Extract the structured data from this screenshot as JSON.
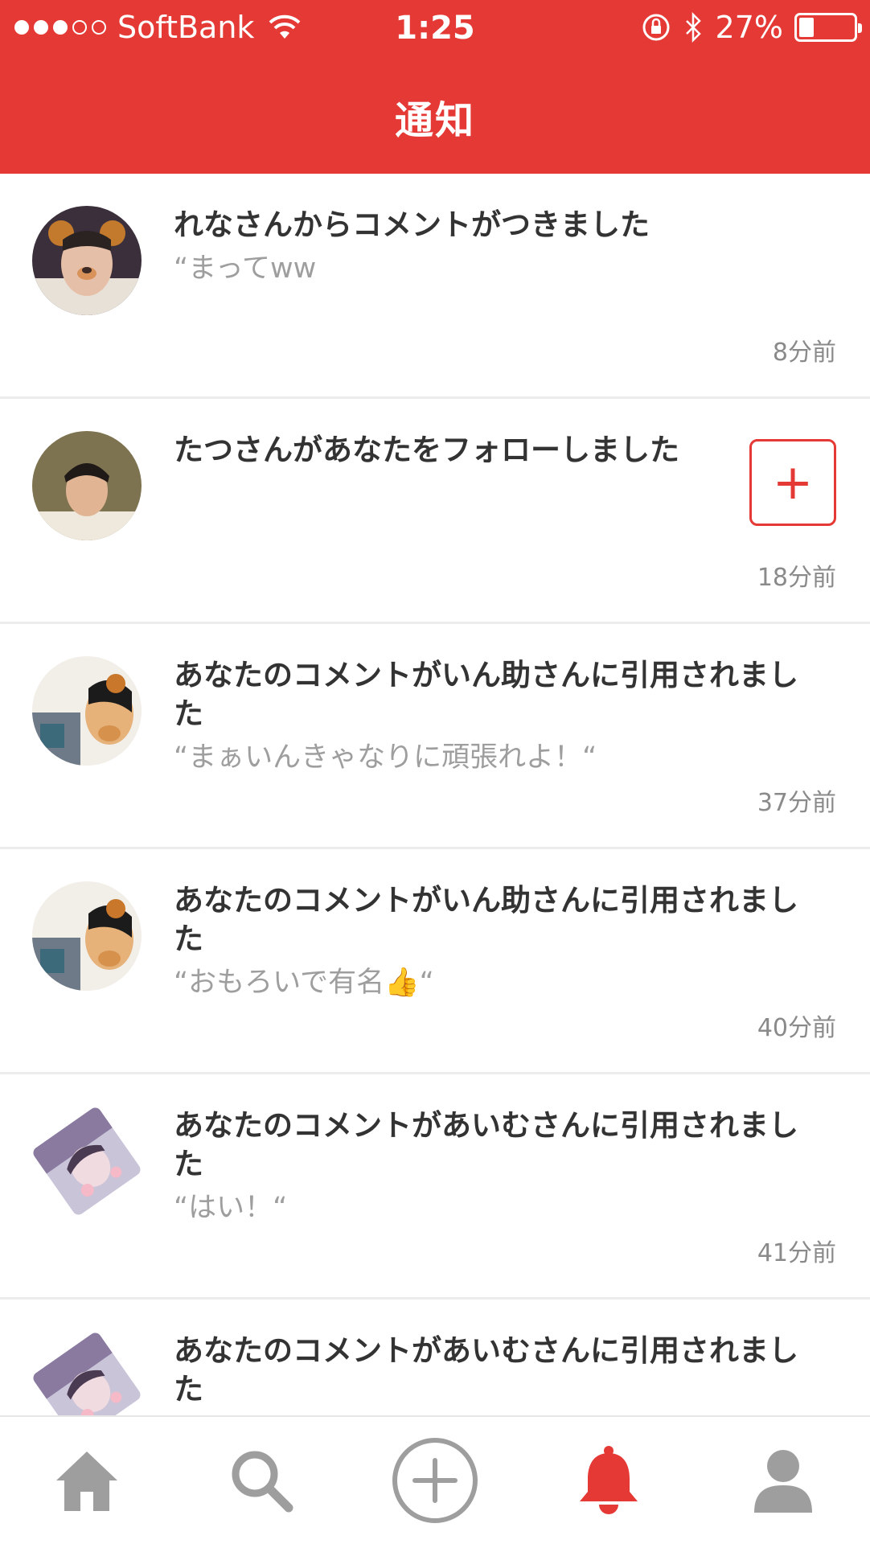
{
  "status_bar": {
    "carrier": "SoftBank",
    "time": "1:25",
    "battery_percent": "27%",
    "battery_level": 0.27
  },
  "header": {
    "title": "通知"
  },
  "notifications": [
    {
      "title": "れなさんからコメントがつきました",
      "quote": "“まってww",
      "time": "8分前"
    },
    {
      "title": "たつさんがあなたをフォローしました",
      "time": "18分前",
      "follow_label": "+"
    },
    {
      "title": "あなたのコメントがいん助さんに引用されました",
      "quote": "“まぁいんきゃなりに頑張れよ！“",
      "time": "37分前"
    },
    {
      "title": "あなたのコメントがいん助さんに引用されました",
      "quote": "“おもろいで有名👍“",
      "time": "40分前"
    },
    {
      "title": "あなたのコメントがあいむさんに引用されました",
      "quote": "“はい！“",
      "time": "41分前"
    },
    {
      "title": "あなたのコメントがあいむさんに引用されました"
    }
  ],
  "tabbar": {
    "items": [
      "home-icon",
      "search-icon",
      "add-icon",
      "bell-icon",
      "profile-icon"
    ],
    "active": "bell-icon",
    "active_color": "#e53935",
    "inactive_color": "#9e9e9e"
  },
  "colors": {
    "accent": "#e53935"
  }
}
